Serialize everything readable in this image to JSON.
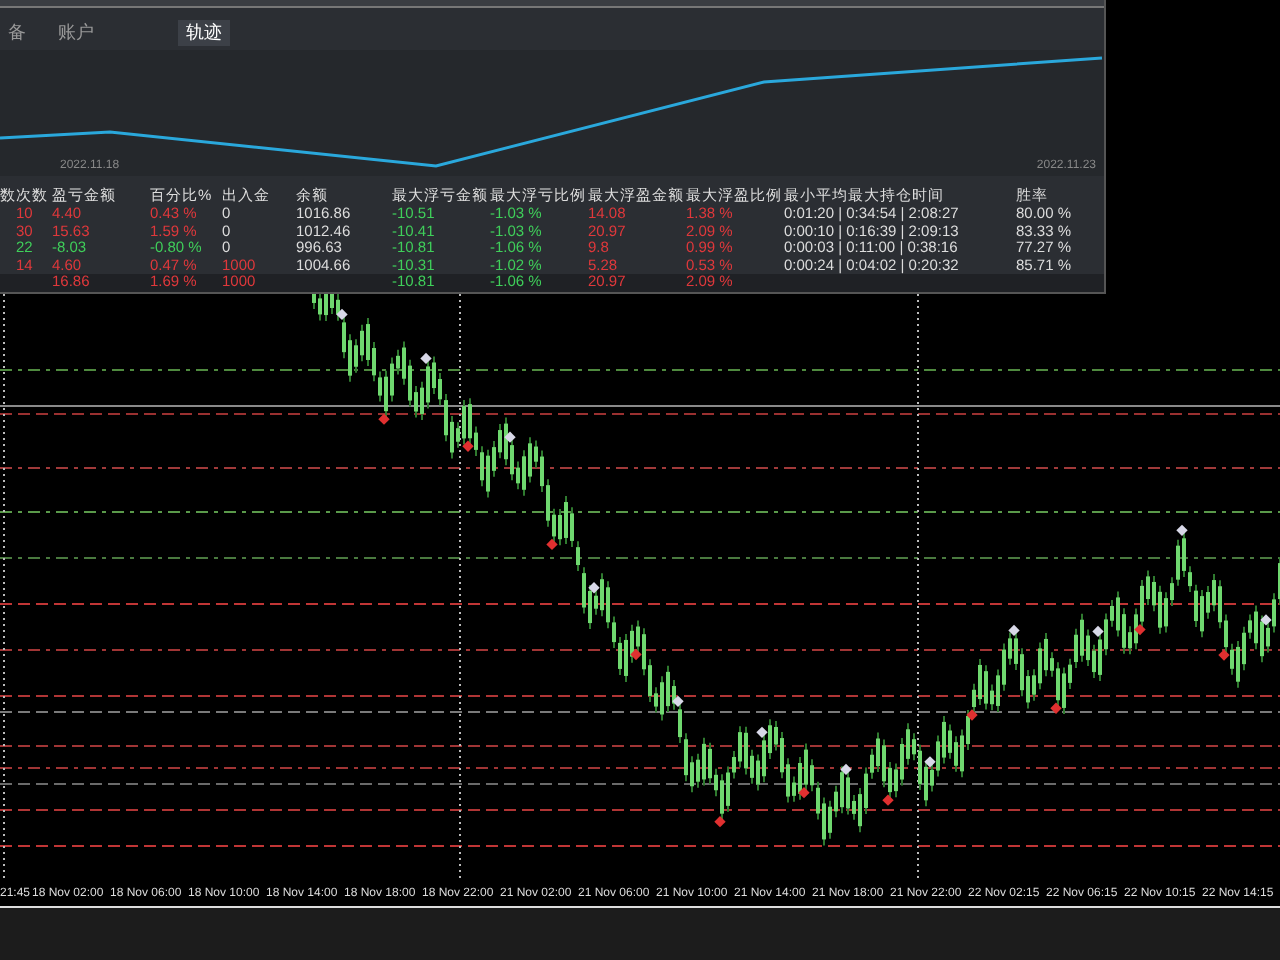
{
  "tabs": [
    {
      "label": "备",
      "selected": false
    },
    {
      "label": "账户",
      "selected": false
    },
    {
      "label": "轨迹",
      "selected": true
    }
  ],
  "equity_chart": {
    "start_date": "2022.11.18",
    "end_date": "2022.11.23"
  },
  "table": {
    "columns": [
      "数",
      "次数",
      "盈亏金额",
      "百分比%",
      "出入金",
      "余额",
      "最大浮亏金额",
      "最大浮亏比例",
      "最大浮盈金额",
      "最大浮盈比例",
      "最小平均最大持仓时间",
      "胜率"
    ],
    "rows": [
      {
        "cells": [
          null,
          {
            "text": "10",
            "color": "#e0383b"
          },
          {
            "text": "4.40",
            "color": "#e0383b"
          },
          {
            "text": "0.43 %",
            "color": "#e0383b"
          },
          {
            "text": "0"
          },
          {
            "text": "1016.86"
          },
          {
            "text": "-10.51",
            "color": "#3fcf5a"
          },
          {
            "text": "-1.03 %",
            "color": "#3fcf5a"
          },
          {
            "text": "14.08",
            "color": "#e0383b"
          },
          {
            "text": "1.38 %",
            "color": "#e0383b"
          },
          {
            "text": "0:01:20 | 0:34:54 | 2:08:27"
          },
          {
            "text": "80.00 %"
          }
        ]
      },
      {
        "cells": [
          null,
          {
            "text": "30",
            "color": "#e0383b"
          },
          {
            "text": "15.63",
            "color": "#e0383b"
          },
          {
            "text": "1.59 %",
            "color": "#e0383b"
          },
          {
            "text": "0"
          },
          {
            "text": "1012.46"
          },
          {
            "text": "-10.41",
            "color": "#3fcf5a"
          },
          {
            "text": "-1.03 %",
            "color": "#3fcf5a"
          },
          {
            "text": "20.97",
            "color": "#e0383b"
          },
          {
            "text": "2.09 %",
            "color": "#e0383b"
          },
          {
            "text": "0:00:10 | 0:16:39 | 2:09:13"
          },
          {
            "text": "83.33 %"
          }
        ]
      },
      {
        "cells": [
          null,
          {
            "text": "22",
            "color": "#3fcf5a"
          },
          {
            "text": "-8.03",
            "color": "#3fcf5a"
          },
          {
            "text": "-0.80 %",
            "color": "#3fcf5a"
          },
          {
            "text": "0"
          },
          {
            "text": "996.63"
          },
          {
            "text": "-10.81",
            "color": "#3fcf5a"
          },
          {
            "text": "-1.06 %",
            "color": "#3fcf5a"
          },
          {
            "text": "9.8",
            "color": "#e0383b"
          },
          {
            "text": "0.99 %",
            "color": "#e0383b"
          },
          {
            "text": "0:00:03 | 0:11:00 | 0:38:16"
          },
          {
            "text": "77.27 %"
          }
        ]
      },
      {
        "cells": [
          null,
          {
            "text": "14",
            "color": "#e0383b"
          },
          {
            "text": "4.60",
            "color": "#e0383b"
          },
          {
            "text": "0.47 %",
            "color": "#e0383b"
          },
          {
            "text": "1000",
            "color": "#e0383b"
          },
          {
            "text": "1004.66"
          },
          {
            "text": "-10.31",
            "color": "#3fcf5a"
          },
          {
            "text": "-1.02 %",
            "color": "#3fcf5a"
          },
          {
            "text": "5.28",
            "color": "#e0383b"
          },
          {
            "text": "0.53 %",
            "color": "#e0383b"
          },
          {
            "text": "0:00:24 | 0:04:02 | 0:20:32"
          },
          {
            "text": "85.71 %"
          }
        ]
      }
    ],
    "total": {
      "cells": [
        null,
        null,
        {
          "text": "16.86",
          "color": "#e0383b"
        },
        {
          "text": "1.69 %",
          "color": "#e0383b"
        },
        {
          "text": "1000",
          "color": "#e0383b"
        },
        null,
        {
          "text": "-10.81",
          "color": "#3fcf5a"
        },
        {
          "text": "-1.06 %",
          "color": "#3fcf5a"
        },
        {
          "text": "20.97",
          "color": "#e0383b"
        },
        {
          "text": "2.09 %",
          "color": "#e0383b"
        },
        null,
        null
      ]
    }
  },
  "time_axis": [
    "21:45",
    "18 Nov 02:00",
    "18 Nov 06:00",
    "18 Nov 10:00",
    "18 Nov 14:00",
    "18 Nov 18:00",
    "18 Nov 22:00",
    "21 Nov 02:00",
    "21 Nov 06:00",
    "21 Nov 10:00",
    "21 Nov 14:00",
    "21 Nov 18:00",
    "21 Nov 22:00",
    "22 Nov 02:15",
    "22 Nov 06:15",
    "22 Nov 10:15",
    "22 Nov 14:15"
  ]
}
